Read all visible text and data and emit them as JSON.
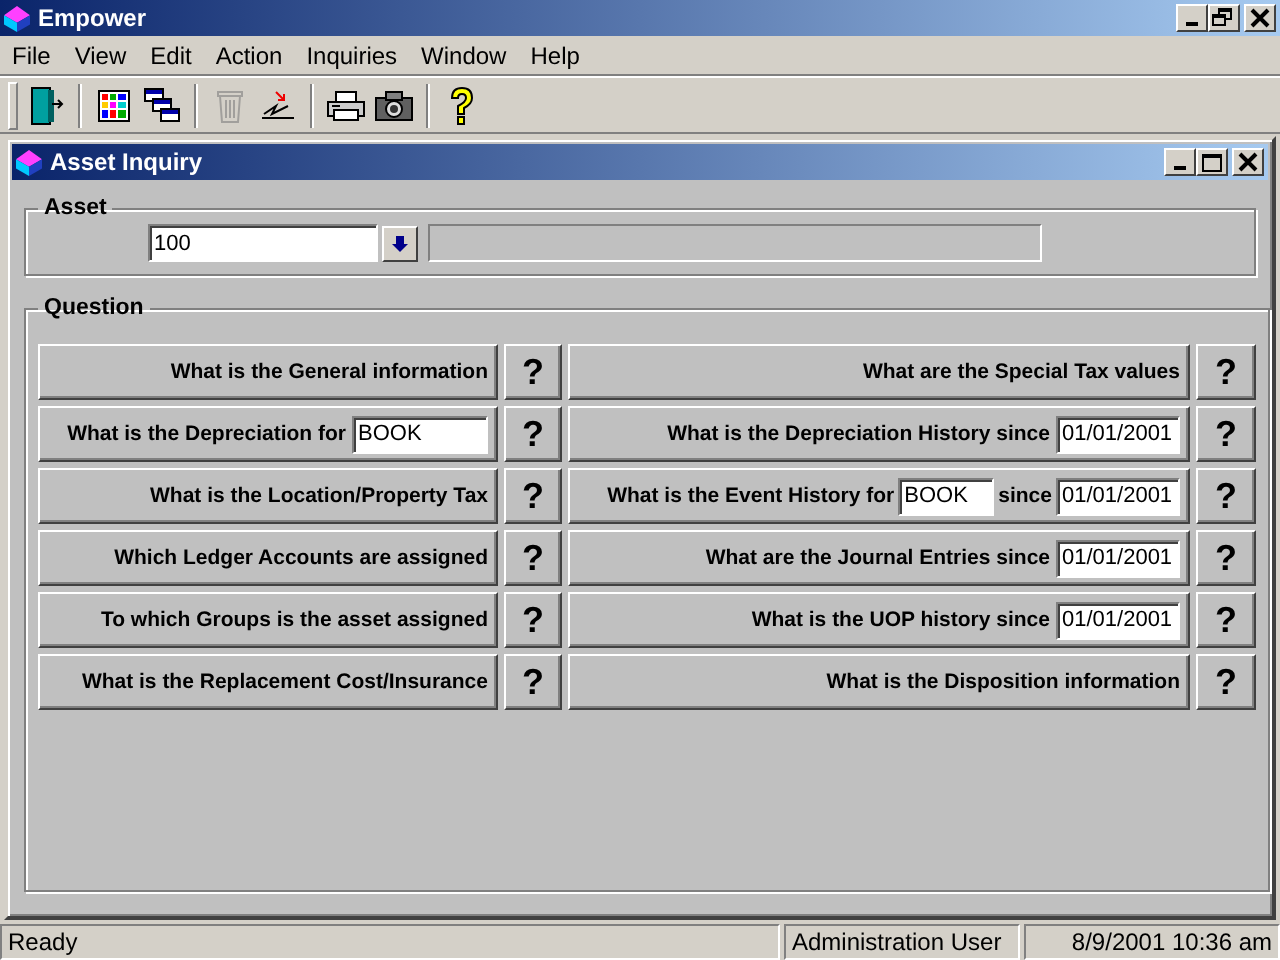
{
  "app": {
    "title": "Empower"
  },
  "menu": [
    "File",
    "View",
    "Edit",
    "Action",
    "Inquiries",
    "Window",
    "Help"
  ],
  "toolbar": [
    [
      {
        "kind": "exit",
        "disabled": false
      }
    ],
    [
      {
        "kind": "grid",
        "disabled": false
      },
      {
        "kind": "windows",
        "disabled": false
      }
    ],
    [
      {
        "kind": "trash",
        "disabled": true
      },
      {
        "kind": "sign",
        "disabled": false
      }
    ],
    [
      {
        "kind": "printer",
        "disabled": false
      },
      {
        "kind": "camera",
        "disabled": false
      }
    ],
    [
      {
        "kind": "help",
        "disabled": false
      }
    ]
  ],
  "window": {
    "title": "Asset Inquiry"
  },
  "asset": {
    "label": "Asset",
    "value": "100"
  },
  "question": {
    "label": "Question",
    "rows": [
      {
        "left": {
          "parts": [
            {
              "kind": "text",
              "text": "What is the General information"
            }
          ],
          "help": "?"
        },
        "right": {
          "parts": [
            {
              "kind": "text",
              "text": "What are the Special Tax values"
            }
          ],
          "help": "?"
        }
      },
      {
        "left": {
          "parts": [
            {
              "kind": "text",
              "text": "What is the Depreciation for"
            },
            {
              "kind": "field",
              "value": "BOOK"
            }
          ],
          "help": "?"
        },
        "right": {
          "parts": [
            {
              "kind": "text",
              "text": "What is the Depreciation History since"
            },
            {
              "kind": "field",
              "value": "01/01/2001"
            }
          ],
          "help": "?"
        }
      },
      {
        "left": {
          "parts": [
            {
              "kind": "text",
              "text": "What is the Location/Property Tax"
            }
          ],
          "help": "?"
        },
        "right": {
          "parts": [
            {
              "kind": "text",
              "text": "What is the Event History for"
            },
            {
              "kind": "field",
              "value": "BOOK"
            },
            {
              "kind": "text",
              "text": "since"
            },
            {
              "kind": "field",
              "value": "01/01/2001"
            }
          ],
          "help": "?"
        }
      },
      {
        "left": {
          "parts": [
            {
              "kind": "text",
              "text": "Which Ledger Accounts are assigned"
            }
          ],
          "help": "?"
        },
        "right": {
          "parts": [
            {
              "kind": "text",
              "text": "What are the Journal Entries since"
            },
            {
              "kind": "field",
              "value": "01/01/2001"
            }
          ],
          "help": "?"
        }
      },
      {
        "left": {
          "parts": [
            {
              "kind": "text",
              "text": "To which Groups is the asset assigned"
            }
          ],
          "help": "?"
        },
        "right": {
          "parts": [
            {
              "kind": "text",
              "text": "What is the UOP history since"
            },
            {
              "kind": "field",
              "value": "01/01/2001"
            }
          ],
          "help": "?"
        }
      },
      {
        "left": {
          "parts": [
            {
              "kind": "text",
              "text": "What is the Replacement Cost/Insurance"
            }
          ],
          "help": "?"
        },
        "right": {
          "parts": [
            {
              "kind": "text",
              "text": "What is the Disposition information"
            }
          ],
          "help": "?"
        }
      }
    ]
  },
  "status_bar": [
    "Ready",
    "Administration User",
    "8/9/2001 10:36 am"
  ]
}
